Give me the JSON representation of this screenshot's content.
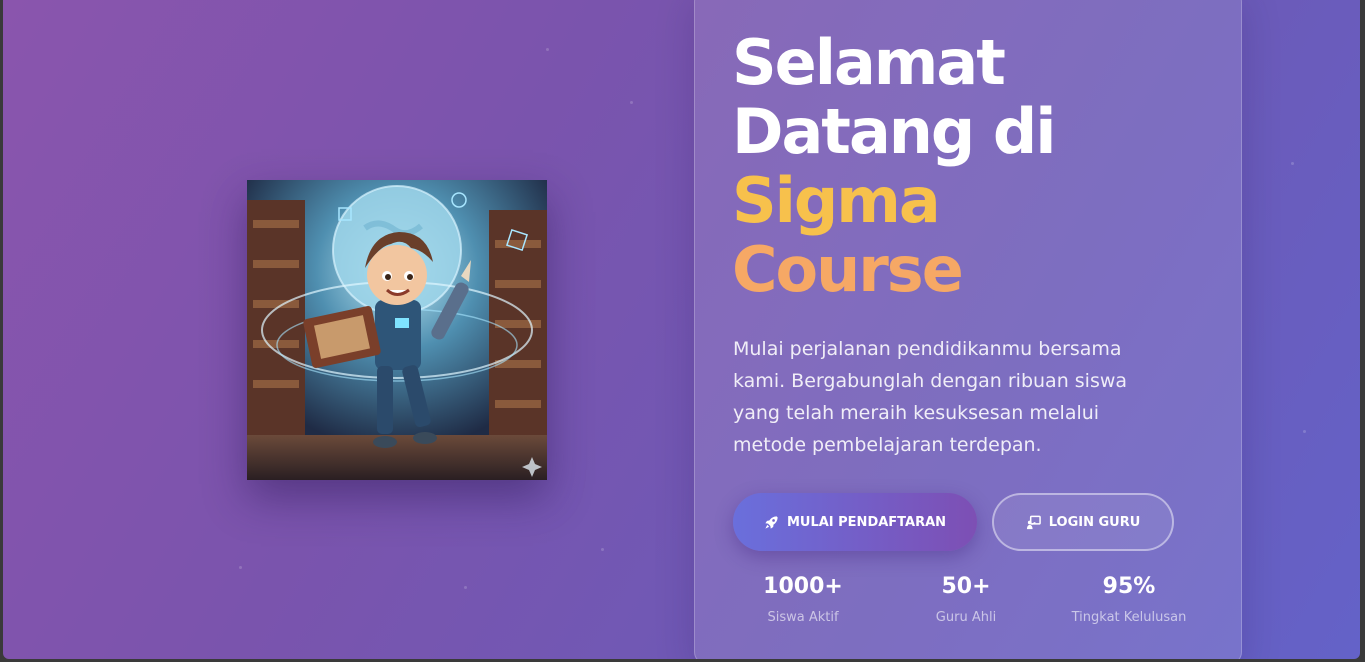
{
  "hero": {
    "title_line1": "Selamat",
    "title_line2": "Datang di",
    "title_line3": "Sigma",
    "title_line4": "Course",
    "description": "Mulai perjalanan pendidikanmu bersama kami. Bergabunglah dengan ribuan siswa yang telah meraih kesuksesan melalui metode pembelajaran terdepan.",
    "image_icon": "student-library-illustration",
    "colors": {
      "background_start": "#8a55ad",
      "background_end": "#6462c8",
      "accent_yellow": "#f7c14c",
      "accent_orange": "#f6a865",
      "primary_button_start": "#6a6fdc",
      "primary_button_end": "#7d4fb4"
    }
  },
  "actions": {
    "register_label": "MULAI PENDAFTARAN",
    "register_icon": "rocket-icon",
    "login_label": "LOGIN GURU",
    "login_icon": "teacher-board-icon"
  },
  "stats": [
    {
      "value": "1000+",
      "label": "Siswa Aktif"
    },
    {
      "value": "50+",
      "label": "Guru Ahli"
    },
    {
      "value": "95%",
      "label": "Tingkat Kelulusan"
    }
  ]
}
